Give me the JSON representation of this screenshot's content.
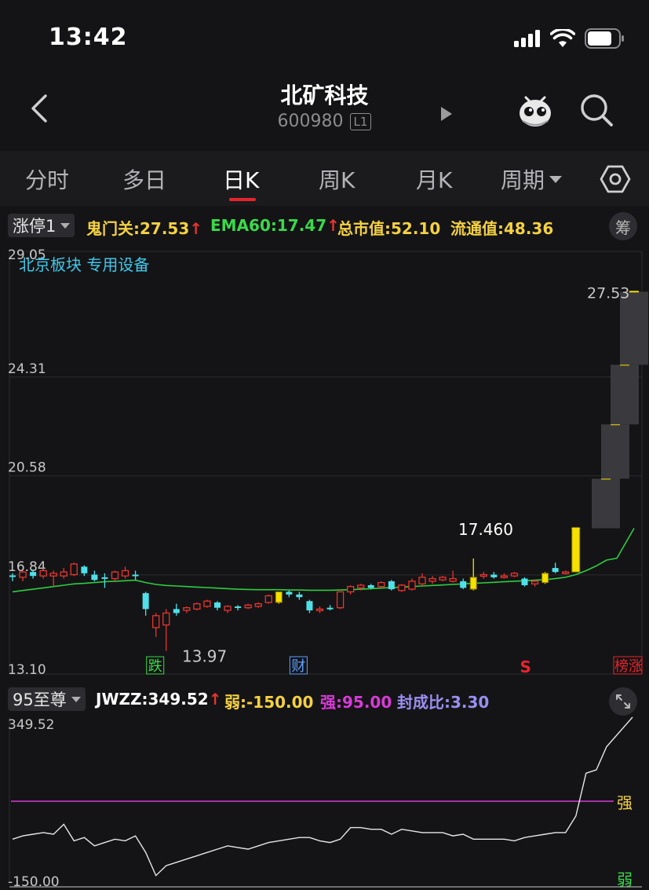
{
  "status_bar": {
    "time": "13:42"
  },
  "header": {
    "stock_name": "北矿科技",
    "stock_code": "600980",
    "level": "L1"
  },
  "tabs": [
    {
      "label": "分时",
      "active": false
    },
    {
      "label": "多日",
      "active": false
    },
    {
      "label": "日K",
      "active": true
    },
    {
      "label": "周K",
      "active": false
    },
    {
      "label": "月K",
      "active": false
    },
    {
      "label": "周期",
      "active": false,
      "dropdown": true
    }
  ],
  "indicator_bar": {
    "selector": "涨停1",
    "items": [
      {
        "label": "鬼门关:27.53",
        "arrow": "↑",
        "color": "#f5d142"
      },
      {
        "label": "EMA60:17.47",
        "arrow": "↑",
        "color": "#3ad94a"
      },
      {
        "label": "总市值:52.10",
        "arrow": "",
        "color": "#f5d142"
      },
      {
        "label": "流通值:48.36",
        "arrow": "",
        "color": "#f5d142"
      }
    ],
    "button": "筹"
  },
  "sub_indicator_bar": {
    "selector": "95至尊",
    "items": [
      {
        "label": "JWZZ:349.52",
        "arrow": "↑",
        "color": "#ffffff"
      },
      {
        "label": "弱:-150.00",
        "arrow": "",
        "color": "#f5d142"
      },
      {
        "label": "强:95.00",
        "arrow": "",
        "color": "#d83ad8"
      },
      {
        "label": "封成比:3.30",
        "arrow": "",
        "color": "#9a8ff0"
      }
    ]
  },
  "colors": {
    "up": "#e8352f",
    "down": "#4fe0e8",
    "limit_up": "#f5e000",
    "ema": "#2ecc40",
    "strong": "#d83ad8",
    "background": "#141416"
  },
  "chart_data": [
    {
      "type": "candlestick",
      "sector_label": "北京板块 专用设备",
      "y_ticks": [
        "29.05",
        "24.31",
        "20.58",
        "16.84",
        "13.10"
      ],
      "ylim": [
        13.1,
        29.05
      ],
      "price_labels": {
        "right_high": "27.53",
        "mid_high": "17.460",
        "low": "13.97"
      },
      "markers": [
        {
          "text": "跌",
          "color": "#3ad94a",
          "index": 14
        },
        {
          "text": "财",
          "color": "#5ea0ff",
          "index": 28
        },
        {
          "text": "S",
          "color": "#e8242b",
          "index": 50
        },
        {
          "text": "榜涨",
          "color": "#e8242b",
          "index": 58
        }
      ],
      "candles": [
        {
          "o": 16.8,
          "h": 16.9,
          "l": 16.6,
          "c": 16.82,
          "kind": "down"
        },
        {
          "o": 16.75,
          "h": 17.0,
          "l": 16.6,
          "c": 16.95,
          "kind": "up"
        },
        {
          "o": 16.95,
          "h": 17.05,
          "l": 16.7,
          "c": 16.8,
          "kind": "down"
        },
        {
          "o": 16.8,
          "h": 17.1,
          "l": 16.7,
          "c": 17.0,
          "kind": "up"
        },
        {
          "o": 16.8,
          "h": 17.0,
          "l": 16.4,
          "c": 16.9,
          "kind": "up"
        },
        {
          "o": 16.8,
          "h": 17.1,
          "l": 16.7,
          "c": 16.95,
          "kind": "up"
        },
        {
          "o": 16.85,
          "h": 17.3,
          "l": 16.8,
          "c": 17.25,
          "kind": "up"
        },
        {
          "o": 17.15,
          "h": 17.2,
          "l": 16.8,
          "c": 16.9,
          "kind": "down"
        },
        {
          "o": 16.85,
          "h": 17.0,
          "l": 16.6,
          "c": 16.65,
          "kind": "down"
        },
        {
          "o": 16.7,
          "h": 16.9,
          "l": 16.35,
          "c": 16.75,
          "kind": "down"
        },
        {
          "o": 16.7,
          "h": 17.0,
          "l": 16.6,
          "c": 16.95,
          "kind": "up"
        },
        {
          "o": 16.8,
          "h": 17.15,
          "l": 16.7,
          "c": 17.0,
          "kind": "up"
        },
        {
          "o": 16.8,
          "h": 17.0,
          "l": 16.65,
          "c": 16.85,
          "kind": "down"
        },
        {
          "o": 16.15,
          "h": 16.2,
          "l": 15.3,
          "c": 15.55,
          "kind": "down"
        },
        {
          "o": 15.3,
          "h": 15.4,
          "l": 14.5,
          "c": 14.85,
          "kind": "up"
        },
        {
          "o": 14.95,
          "h": 15.55,
          "l": 13.97,
          "c": 15.4,
          "kind": "up"
        },
        {
          "o": 15.55,
          "h": 15.75,
          "l": 15.3,
          "c": 15.4,
          "kind": "down"
        },
        {
          "o": 15.5,
          "h": 15.65,
          "l": 15.4,
          "c": 15.6,
          "kind": "up"
        },
        {
          "o": 15.55,
          "h": 15.8,
          "l": 15.5,
          "c": 15.75,
          "kind": "up"
        },
        {
          "o": 15.65,
          "h": 15.9,
          "l": 15.6,
          "c": 15.85,
          "kind": "up"
        },
        {
          "o": 15.8,
          "h": 15.85,
          "l": 15.5,
          "c": 15.6,
          "kind": "down"
        },
        {
          "o": 15.5,
          "h": 15.7,
          "l": 15.4,
          "c": 15.65,
          "kind": "up"
        },
        {
          "o": 15.65,
          "h": 15.7,
          "l": 15.5,
          "c": 15.6,
          "kind": "down"
        },
        {
          "o": 15.6,
          "h": 15.75,
          "l": 15.55,
          "c": 15.7,
          "kind": "up"
        },
        {
          "o": 15.65,
          "h": 15.8,
          "l": 15.6,
          "c": 15.75,
          "kind": "up"
        },
        {
          "o": 15.8,
          "h": 16.1,
          "l": 15.75,
          "c": 16.05,
          "kind": "up"
        },
        {
          "o": 15.8,
          "h": 16.2,
          "l": 15.75,
          "c": 16.2,
          "kind": "limit_up"
        },
        {
          "o": 16.2,
          "h": 16.25,
          "l": 16.0,
          "c": 16.1,
          "kind": "down"
        },
        {
          "o": 16.1,
          "h": 16.2,
          "l": 15.9,
          "c": 16.0,
          "kind": "down"
        },
        {
          "o": 15.85,
          "h": 15.9,
          "l": 15.4,
          "c": 15.5,
          "kind": "down"
        },
        {
          "o": 15.5,
          "h": 15.65,
          "l": 15.4,
          "c": 15.55,
          "kind": "up"
        },
        {
          "o": 15.6,
          "h": 15.7,
          "l": 15.5,
          "c": 15.6,
          "kind": "down"
        },
        {
          "o": 15.6,
          "h": 16.2,
          "l": 15.55,
          "c": 16.2,
          "kind": "up"
        },
        {
          "o": 16.2,
          "h": 16.45,
          "l": 16.1,
          "c": 16.4,
          "kind": "up"
        },
        {
          "o": 16.35,
          "h": 16.5,
          "l": 16.25,
          "c": 16.45,
          "kind": "up"
        },
        {
          "o": 16.45,
          "h": 16.5,
          "l": 16.3,
          "c": 16.35,
          "kind": "down"
        },
        {
          "o": 16.4,
          "h": 16.6,
          "l": 16.35,
          "c": 16.55,
          "kind": "up"
        },
        {
          "o": 16.6,
          "h": 16.65,
          "l": 16.25,
          "c": 16.3,
          "kind": "down"
        },
        {
          "o": 16.25,
          "h": 16.5,
          "l": 16.2,
          "c": 16.45,
          "kind": "up"
        },
        {
          "o": 16.3,
          "h": 16.7,
          "l": 16.25,
          "c": 16.6,
          "kind": "up"
        },
        {
          "o": 16.5,
          "h": 16.9,
          "l": 16.45,
          "c": 16.75,
          "kind": "up"
        },
        {
          "o": 16.6,
          "h": 16.8,
          "l": 16.5,
          "c": 16.7,
          "kind": "up"
        },
        {
          "o": 16.65,
          "h": 16.8,
          "l": 16.6,
          "c": 16.75,
          "kind": "up"
        },
        {
          "o": 16.6,
          "h": 17.0,
          "l": 16.55,
          "c": 16.7,
          "kind": "up"
        },
        {
          "o": 16.6,
          "h": 16.7,
          "l": 16.3,
          "c": 16.35,
          "kind": "down"
        },
        {
          "o": 16.3,
          "h": 17.46,
          "l": 16.25,
          "c": 16.75,
          "kind": "limit_up"
        },
        {
          "o": 16.8,
          "h": 16.95,
          "l": 16.7,
          "c": 16.85,
          "kind": "up"
        },
        {
          "o": 16.85,
          "h": 16.95,
          "l": 16.7,
          "c": 16.75,
          "kind": "down"
        },
        {
          "o": 16.8,
          "h": 16.9,
          "l": 16.7,
          "c": 16.8,
          "kind": "up"
        },
        {
          "o": 16.8,
          "h": 16.95,
          "l": 16.75,
          "c": 16.9,
          "kind": "up"
        },
        {
          "o": 16.7,
          "h": 16.75,
          "l": 16.4,
          "c": 16.45,
          "kind": "down"
        },
        {
          "o": 16.5,
          "h": 16.65,
          "l": 16.4,
          "c": 16.6,
          "kind": "up"
        },
        {
          "o": 16.55,
          "h": 16.95,
          "l": 16.5,
          "c": 16.9,
          "kind": "limit_up"
        },
        {
          "o": 16.95,
          "h": 17.3,
          "l": 16.9,
          "c": 17.1,
          "kind": "down"
        },
        {
          "o": 16.9,
          "h": 17.0,
          "l": 16.85,
          "c": 16.95,
          "kind": "up"
        },
        {
          "o": 16.95,
          "h": 18.6,
          "l": 16.95,
          "c": 18.6,
          "kind": "limit_up"
        },
        {
          "o": 18.6,
          "h": 20.47,
          "l": 18.6,
          "c": 20.47,
          "kind": "limit_up"
        },
        {
          "o": 20.47,
          "h": 22.52,
          "l": 20.47,
          "c": 22.52,
          "kind": "limit_up"
        },
        {
          "o": 22.52,
          "h": 24.77,
          "l": 22.52,
          "c": 24.77,
          "kind": "limit_up"
        },
        {
          "o": 24.77,
          "h": 27.53,
          "l": 24.77,
          "c": 27.53,
          "kind": "limit_up"
        }
      ],
      "ema60": [
        16.2,
        16.25,
        16.3,
        16.35,
        16.4,
        16.45,
        16.5,
        16.52,
        16.55,
        16.58,
        16.6,
        16.62,
        16.64,
        16.55,
        16.48,
        16.44,
        16.42,
        16.4,
        16.38,
        16.36,
        16.34,
        16.32,
        16.3,
        16.29,
        16.28,
        16.28,
        16.28,
        16.27,
        16.27,
        16.26,
        16.26,
        16.26,
        16.27,
        16.28,
        16.3,
        16.32,
        16.34,
        16.36,
        16.38,
        16.4,
        16.42,
        16.44,
        16.46,
        16.48,
        16.5,
        16.52,
        16.54,
        16.56,
        16.58,
        16.6,
        16.62,
        16.64,
        16.66,
        16.7,
        16.75,
        16.85,
        17.0,
        17.18,
        17.4,
        17.47
      ]
    },
    {
      "type": "line",
      "series": [
        {
          "name": "JWZZ",
          "values": [
            -20,
            -10,
            -5,
            0,
            -5,
            25,
            -25,
            -15,
            -40,
            -30,
            -20,
            -25,
            -10,
            -60,
            -130,
            -100,
            -90,
            -80,
            -70,
            -60,
            -50,
            -40,
            -45,
            -50,
            -40,
            -30,
            -25,
            -20,
            -15,
            -15,
            -25,
            -30,
            -20,
            15,
            15,
            10,
            10,
            -5,
            10,
            5,
            0,
            0,
            0,
            -10,
            -5,
            -20,
            -20,
            -20,
            -20,
            -25,
            -15,
            -10,
            -5,
            0,
            0,
            50,
            180,
            190,
            260,
            349.52
          ]
        }
      ],
      "y_ticks": [
        "349.52",
        "-150.00"
      ],
      "ylim": [
        -150,
        349.52
      ],
      "strong_level": 95,
      "right_labels": {
        "strong": "强",
        "weak": "弱"
      }
    }
  ]
}
